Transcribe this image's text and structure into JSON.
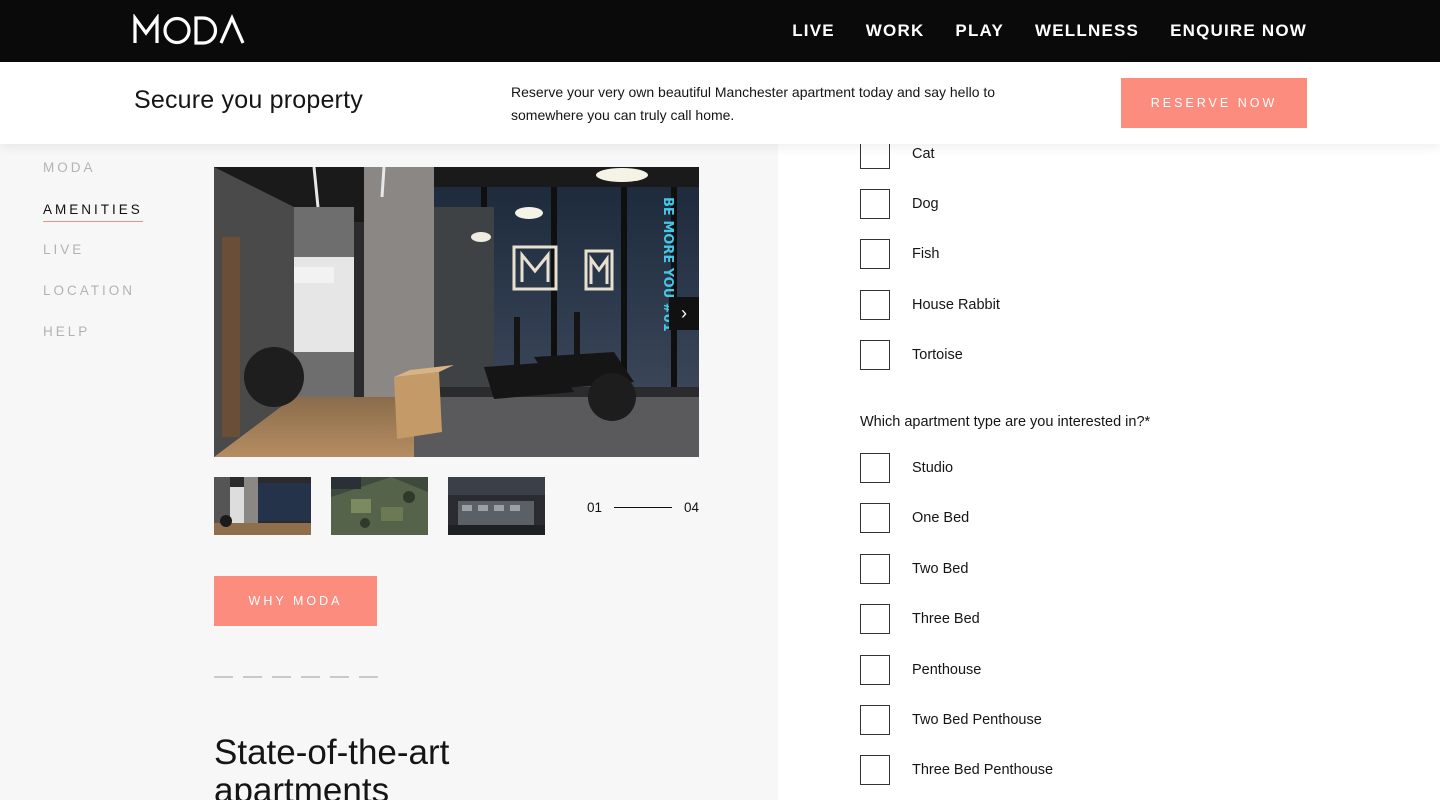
{
  "brand": {
    "logo": "MODA"
  },
  "nav": {
    "links": [
      "LIVE",
      "WORK",
      "PLAY",
      "WELLNESS",
      "ENQUIRE NOW"
    ]
  },
  "reserve_bar": {
    "title": "Secure you property",
    "text": "Reserve your very own beautiful Manchester apartment today and say hello to somewhere you can truly call home.",
    "button": "RESERVE NOW",
    "accent_color": "#fb8c7e"
  },
  "side_nav": {
    "items": [
      "MODA",
      "AMENITIES",
      "LIVE",
      "LOCATION",
      "HELP"
    ],
    "active": "AMENITIES"
  },
  "gallery": {
    "counter_current": "01",
    "counter_total": "04",
    "neon_text": "BE MORE YOU #01",
    "next_icon": "chevron-right-icon"
  },
  "why_button": "WHY MODA",
  "section_title": "State-of-the-art apartments",
  "form": {
    "pets": [
      "Cat",
      "Dog",
      "Fish",
      "House Rabbit",
      "Tortoise"
    ],
    "apartment_question": "Which apartment type are you interested in?*",
    "apartment_types": [
      "Studio",
      "One Bed",
      "Two Bed",
      "Three Bed",
      "Penthouse",
      "Two Bed Penthouse",
      "Three Bed Penthouse"
    ]
  }
}
